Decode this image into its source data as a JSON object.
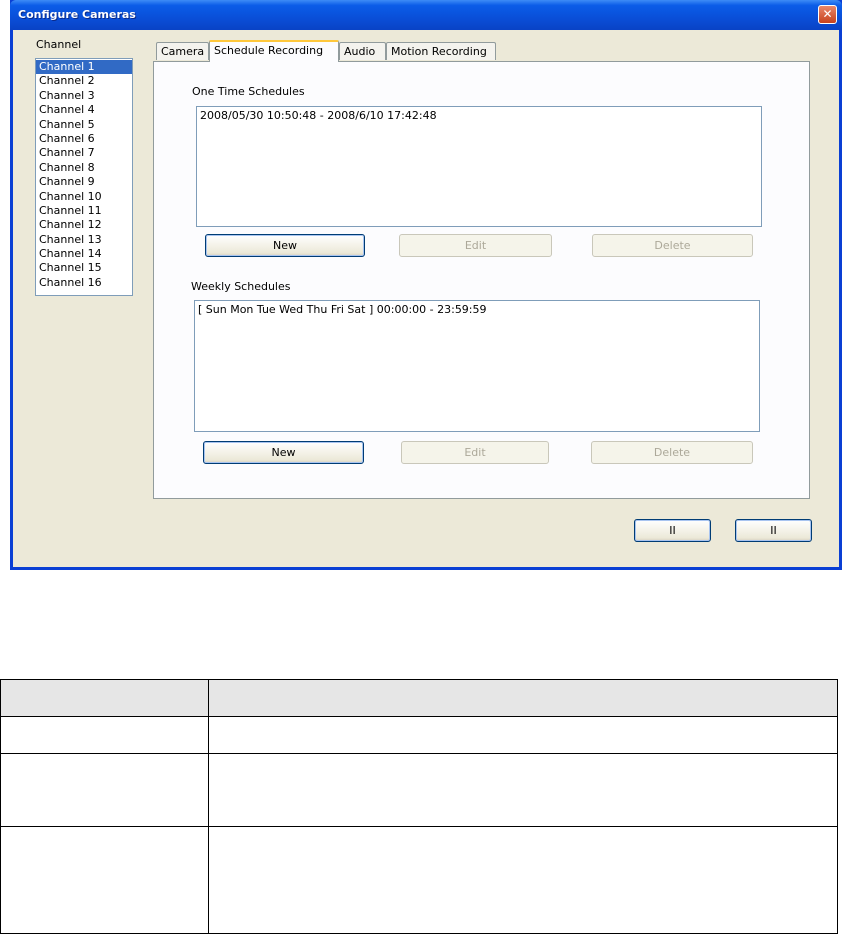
{
  "window": {
    "title": "Configure Cameras",
    "close_glyph": "✕"
  },
  "channels": {
    "label": "Channel",
    "items": [
      "Channel 1",
      "Channel 2",
      "Channel 3",
      "Channel 4",
      "Channel 5",
      "Channel 6",
      "Channel 7",
      "Channel 8",
      "Channel 9",
      "Channel 10",
      "Channel 11",
      "Channel 12",
      "Channel 13",
      "Channel 14",
      "Channel 15",
      "Channel 16"
    ],
    "selected_index": 0
  },
  "tabs": [
    {
      "label": "Camera",
      "active": false
    },
    {
      "label": "Schedule Recording",
      "active": true
    },
    {
      "label": "Audio",
      "active": false
    },
    {
      "label": "Motion Recording",
      "active": false
    }
  ],
  "one_time": {
    "label": "One Time Schedules",
    "entries": [
      "2008/05/30 10:50:48 - 2008/6/10 17:42:48"
    ],
    "new_label": "New",
    "edit_label": "Edit",
    "delete_label": "Delete"
  },
  "weekly": {
    "label": "Weekly Schedules",
    "entries": [
      "[ Sun Mon Tue Wed Thu Fri Sat ] 00:00:00 - 23:59:59"
    ],
    "new_label": "New",
    "edit_label": "Edit",
    "delete_label": "Delete"
  },
  "dialog_buttons": {
    "ok_label": "II",
    "cancel_label": "II"
  },
  "table": {
    "header": [
      "",
      ""
    ],
    "rows": [
      [
        "",
        ""
      ],
      [
        "",
        ""
      ],
      [
        "",
        ""
      ]
    ]
  },
  "colors": {
    "titlebar": "#0a4fd8",
    "selection": "#316ac5",
    "active_tab_accent": "#ffc83c",
    "dialog_bg": "#ece9d8"
  }
}
